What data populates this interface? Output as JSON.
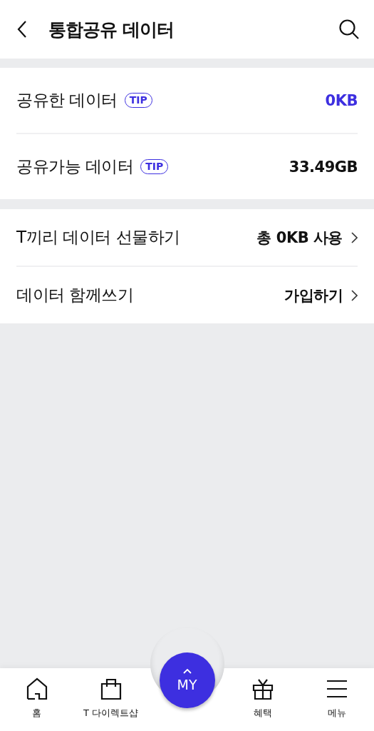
{
  "header": {
    "title": "통합공유 데이터"
  },
  "sections": [
    {
      "rows": [
        {
          "label": "공유한 데이터",
          "tip": "TIP",
          "value": "0KB",
          "highlight": true,
          "chevron": false
        },
        {
          "label": "공유가능 데이터",
          "tip": "TIP",
          "value": "33.49GB",
          "highlight": false,
          "chevron": false
        }
      ]
    },
    {
      "rows": [
        {
          "label": "T끼리 데이터 선물하기",
          "value": "총 0KB 사용",
          "highlight": false,
          "chevron": true
        },
        {
          "label": "데이터 함께쓰기",
          "value": "가입하기",
          "highlight": false,
          "chevron": true
        }
      ]
    }
  ],
  "bottom_nav": {
    "items": [
      {
        "kind": "tab",
        "label": "홈"
      },
      {
        "kind": "tab",
        "label": "T 다이렉트샵"
      },
      {
        "kind": "fab",
        "label": "MY"
      },
      {
        "kind": "tab",
        "label": "혜택"
      },
      {
        "kind": "tab",
        "label": "메뉴"
      }
    ]
  }
}
